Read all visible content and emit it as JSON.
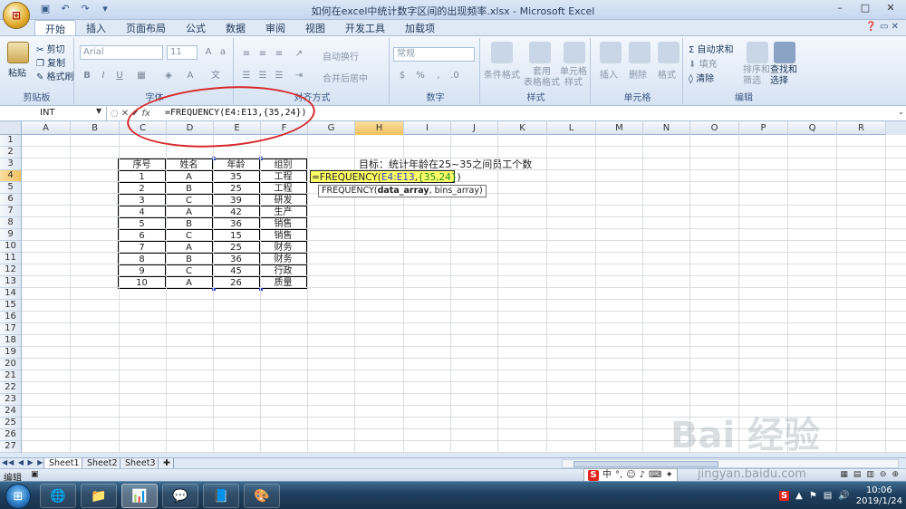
{
  "window": {
    "title": "如何在excel中统计数字区间的出现频率.xlsx - Microsoft Excel",
    "controls": [
      "–",
      "□",
      "✕"
    ]
  },
  "ribbon_tabs": [
    "开始",
    "插入",
    "页面布局",
    "公式",
    "数据",
    "审阅",
    "视图",
    "开发工具",
    "加载项"
  ],
  "ribbon": {
    "clipboard": {
      "paste": "粘贴",
      "cut": "剪切",
      "copy": "复制",
      "format_painter": "格式刷",
      "label": "剪贴板"
    },
    "font": {
      "name": "Arial",
      "size": "11",
      "label": "字体"
    },
    "alignment": {
      "wrap": "自动换行",
      "merge": "合并后居中",
      "label": "对齐方式"
    },
    "number": {
      "format": "常规",
      "label": "数字"
    },
    "styles": {
      "conditional": "条件格式",
      "table": "套用\n表格格式",
      "cell_style": "单元格\n样式",
      "label": "样式"
    },
    "cells": {
      "insert": "插入",
      "delete": "删除",
      "format": "格式",
      "label": "单元格"
    },
    "editing": {
      "autosum": "自动求和",
      "fill": "填充",
      "clear": "清除",
      "sort": "排序和\n筛选",
      "find": "查找和\n选择",
      "label": "编辑"
    }
  },
  "formula_bar": {
    "name_box": "INT",
    "formula": "=FREQUENCY(E4:E13,{35,24})"
  },
  "columns": [
    "A",
    "B",
    "C",
    "D",
    "E",
    "F",
    "G",
    "H",
    "I",
    "J",
    "K",
    "L",
    "M",
    "N",
    "O",
    "P",
    "Q",
    "R"
  ],
  "rows": [
    "1",
    "2",
    "3",
    "4",
    "5",
    "6",
    "7",
    "8",
    "9",
    "10",
    "11",
    "12",
    "13",
    "14",
    "15",
    "16",
    "17",
    "18",
    "19",
    "20",
    "21",
    "22",
    "23",
    "24",
    "25",
    "26",
    "27"
  ],
  "table": {
    "headers": [
      "序号",
      "姓名",
      "年龄",
      "组别"
    ],
    "rows": [
      [
        "1",
        "A",
        "35",
        "工程"
      ],
      [
        "2",
        "B",
        "25",
        "工程"
      ],
      [
        "3",
        "C",
        "39",
        "研发"
      ],
      [
        "4",
        "A",
        "42",
        "生产"
      ],
      [
        "5",
        "B",
        "36",
        "销售"
      ],
      [
        "6",
        "C",
        "15",
        "销售"
      ],
      [
        "7",
        "A",
        "25",
        "财务"
      ],
      [
        "8",
        "B",
        "36",
        "财务"
      ],
      [
        "9",
        "C",
        "45",
        "行政"
      ],
      [
        "10",
        "A",
        "26",
        "质量"
      ]
    ]
  },
  "note": "目标：统计年龄在25~35之间员工个数",
  "editing_cell": {
    "prefix": "=FREQUENCY(",
    "ref1": "E4:E13",
    "comma": ",",
    "ref2": "{35,24}",
    "suffix": ")"
  },
  "tooltip": {
    "fn": "FREQUENCY(",
    "arg1": "data_array",
    "rest": ", bins_array)"
  },
  "sheet_tabs": [
    "Sheet1",
    "Sheet2",
    "Sheet3"
  ],
  "status": {
    "mode": "编辑"
  },
  "ime": {
    "logo": "S",
    "lang": "中"
  },
  "clock": {
    "time": "10:06",
    "date": "2019/1/24"
  },
  "watermark": "Bai 经验",
  "watermark_url": "jingyan.baidu.com"
}
